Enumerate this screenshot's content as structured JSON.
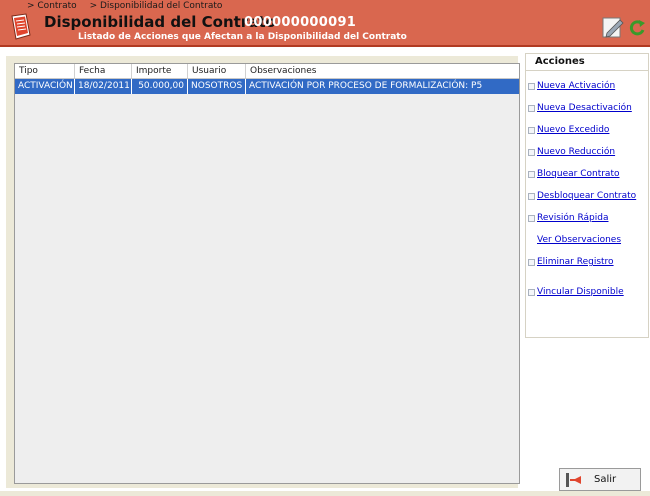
{
  "header": {
    "breadcrumb": [
      "> Contrato",
      "> Disponibilidad del Contrato"
    ],
    "title": "Disponibilidad del Contrato",
    "contract_number": "000000000091",
    "subtitle": "Listado de Acciones que Afectan a la Disponibilidad del Contrato"
  },
  "table": {
    "columns": [
      "Tipo",
      "Fecha",
      "Importe",
      "Usuario",
      "Observaciones"
    ],
    "rows": [
      [
        "ACTIVACIÓN",
        "18/02/2011",
        "50.000,00",
        "NOSOTROS",
        "ACTIVACIÓN POR PROCESO DE FORMALIZACIÓN: P5"
      ]
    ]
  },
  "actions": {
    "title": "Acciones",
    "items": [
      {
        "label": "Nueva Activación"
      },
      {
        "label": "Nueva Desactivación"
      },
      {
        "label": "Nuevo Excedido"
      },
      {
        "label": "Nuevo Reducción"
      },
      {
        "label": "Bloquear Contrato"
      },
      {
        "label": "Desbloquear Contrato"
      },
      {
        "label": "Revisión Rápida"
      },
      {
        "label": "Ver Observaciones"
      },
      {
        "label": "Eliminar Registro"
      },
      {
        "label": "Vincular Disponible"
      }
    ]
  },
  "footer": {
    "exit_label": "Salir"
  },
  "colors": {
    "header": "#d9674f",
    "selected_row": "#316ac5",
    "panel": "#ece9d8",
    "link": "#0000cc"
  },
  "icons": {
    "header": "document-icon",
    "edit": "edit-icon",
    "refresh": "refresh-icon",
    "exit": "exit-icon"
  }
}
